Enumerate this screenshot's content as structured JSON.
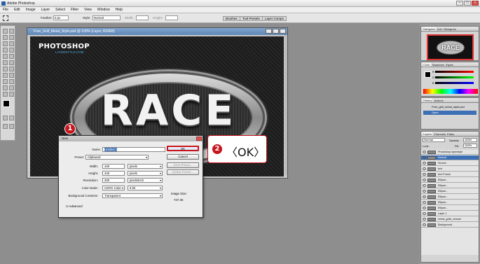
{
  "app": {
    "title": "Adobe Photoshop"
  },
  "menu": [
    "File",
    "Edit",
    "Image",
    "Layer",
    "Select",
    "Filter",
    "View",
    "Window",
    "Help"
  ],
  "options": {
    "feather_label": "Feather:",
    "feather_value": "0 px",
    "style_label": "Style:",
    "style_value": "Normal",
    "width_label": "Width:",
    "height_label": "Height:",
    "tabs": [
      "Brushes",
      "Tool Presets",
      "Layer Comps"
    ]
  },
  "document": {
    "title": "Free_Grill_Metal_Style.psd @ 100% (Layer, RGB/8)",
    "logo_line1": "PHOTOSHOP",
    "logo_line2": "LAYERSTYLE.COM",
    "plate_text": "RACE"
  },
  "panels": {
    "navigator": {
      "tabs": [
        "Navigator",
        "Info",
        "Histogram"
      ],
      "thumb_text": "RACE"
    },
    "color": {
      "tabs": [
        "Color",
        "Swatches",
        "Styles"
      ],
      "channels": [
        "R",
        "G",
        "B"
      ]
    },
    "history": {
      "tabs": [
        "History",
        "Actions"
      ],
      "items": [
        "Free_grill_metal_style.psd",
        "Open"
      ]
    },
    "layers": {
      "tabs": [
        "Layers",
        "Channels",
        "Paths"
      ],
      "blend_mode": "Normal",
      "opacity_label": "Opacity:",
      "opacity": "100%",
      "fill_label": "Fill:",
      "fill": "100%",
      "lock_label": "Lock:",
      "rows": [
        "Photoshop layerstyle",
        "Normal",
        "Screen",
        "text",
        "text Frame",
        "Ellipse...",
        "Ellipse...",
        "Ellipse...",
        "Ellipse...",
        "Ellipse...",
        "Ellipse...",
        "Layer 1",
        "metal_grille_texture",
        "Background"
      ]
    }
  },
  "dialog": {
    "title": "New",
    "name_label": "Name:",
    "name_value": "Untitled-1",
    "preset_label": "Preset:",
    "preset_value": "Clipboard",
    "width_label": "Width:",
    "width_value": "440",
    "width_unit": "pixels",
    "height_label": "Height:",
    "height_value": "440",
    "height_unit": "pixels",
    "resolution_label": "Resolution:",
    "resolution_value": "200",
    "resolution_unit": "pixels/inch",
    "color_mode_label": "Color Mode:",
    "color_mode_value": "CMYK Color",
    "bit_depth": "8 bit",
    "background_label": "Background Contents:",
    "background_value": "Transparent",
    "advanced_label": "Advanced",
    "ok_label": "OK",
    "cancel_label": "Cancel",
    "save_preset_label": "Save Preset...",
    "delete_preset_label": "Delete Preset...",
    "image_size_label": "Image Size:",
    "image_size_value": "747.3K"
  },
  "annotations": {
    "badge1": "1",
    "badge2": "2",
    "ok_callout": "〈OK〉",
    "accent": "#c8141c"
  },
  "status": {
    "zoom": "100%"
  }
}
